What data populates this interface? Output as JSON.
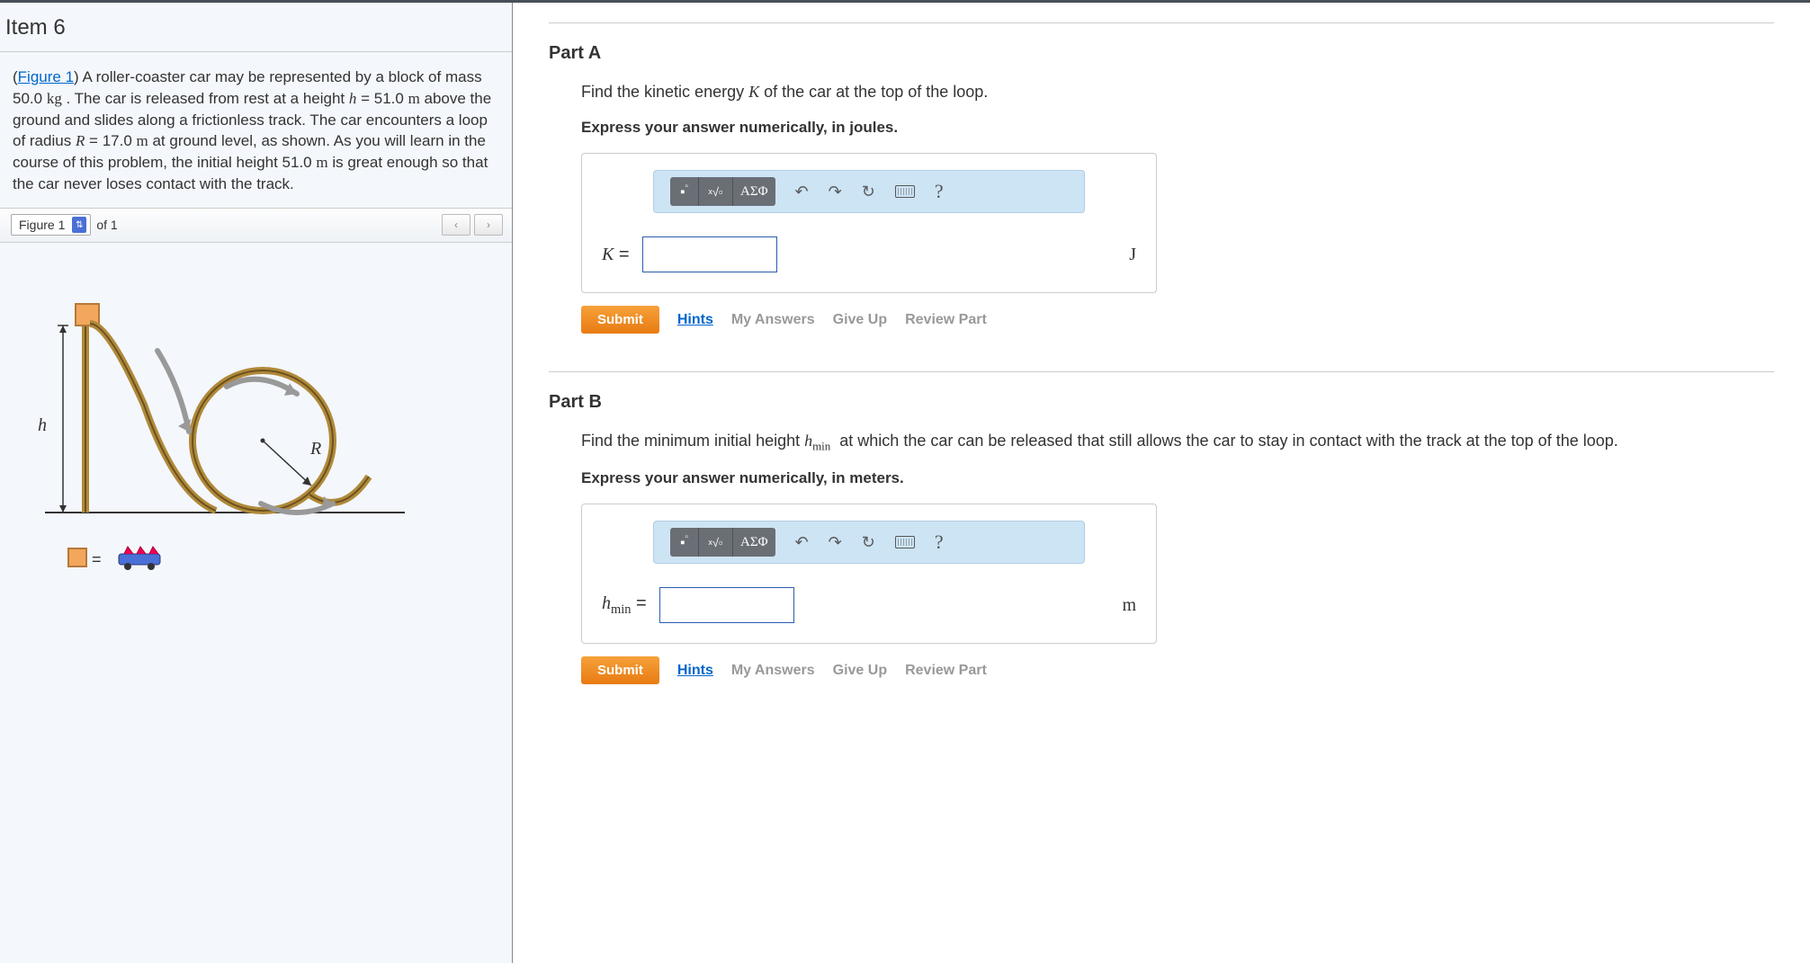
{
  "left": {
    "item_title": "Item 6",
    "figure_link": "Figure 1",
    "problem_p1_a": ") A roller-coaster car may be represented by a block of mass 50.0 ",
    "problem_kg": "kg",
    "problem_p1_b": " . The car is released from rest at a height ",
    "problem_h": "h",
    "problem_p1_c": " = 51.0 ",
    "problem_m1": "m",
    "problem_p1_d": " above the ground and slides along a frictionless track. The car encounters a loop of radius ",
    "problem_R": "R",
    "problem_p1_e": " = 17.0 ",
    "problem_m2": "m",
    "problem_p1_f": " at ground level, as shown. As you will learn in the course of this problem, the initial height 51.0 ",
    "problem_m3": "m",
    "problem_p1_g": " is great enough so that the car never loses contact with the track.",
    "figure_selector": "Figure 1",
    "of_text": "of 1",
    "nav_prev": "‹",
    "nav_next": "›",
    "diagram": {
      "h_label": "h",
      "r_label": "R",
      "equals": "="
    }
  },
  "partA": {
    "title": "Part A",
    "question_a": "Find the kinetic energy ",
    "question_K": "K",
    "question_b": " of the car at the top of the loop.",
    "hint": "Express your answer numerically, in joules.",
    "var_label": "K",
    "equals": "=",
    "unit": "J"
  },
  "partB": {
    "title": "Part B",
    "question_a": "Find the minimum initial height ",
    "question_h": "h",
    "question_sub": "min",
    "question_b": " at which the car can be released that still allows the car to stay in contact with the track at the top of the loop.",
    "hint": "Express your answer numerically, in meters.",
    "var_label": "h",
    "var_sub": "min",
    "equals": "=",
    "unit": "m"
  },
  "toolbar": {
    "templates_icon": "▪",
    "sqrt_icon": "√",
    "greek": "ΑΣΦ",
    "undo": "↶",
    "redo": "↷",
    "reset": "↻",
    "help": "?"
  },
  "actions": {
    "submit": "Submit",
    "hints": "Hints",
    "my_answers": "My Answers",
    "give_up": "Give Up",
    "review": "Review Part"
  }
}
